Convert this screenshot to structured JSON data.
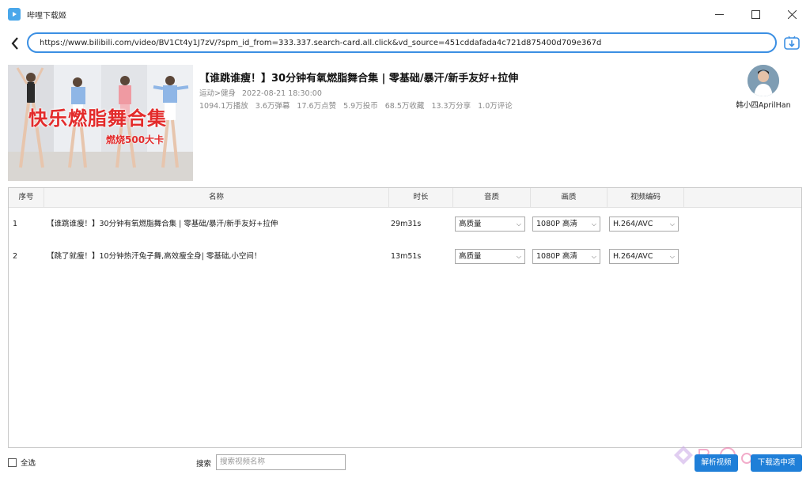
{
  "window": {
    "title": "哔哩下载姬"
  },
  "address": {
    "url": "https://www.bilibili.com/video/BV1Ct4y1J7zV/?spm_id_from=333.337.search-card.all.click&vd_source=451cddafada4c721d875400d709e367d"
  },
  "video": {
    "title": "【谁跳谁瘦！】30分钟有氧燃脂舞合集 | 零基础/暴汗/新手友好+拉伸",
    "category": "运动>健身",
    "published": "2022-08-21 18:30:00",
    "stats": [
      "1094.1万播放",
      "3.6万弹幕",
      "17.6万点赞",
      "5.9万投币",
      "68.5万收藏",
      "13.3万分享",
      "1.0万评论"
    ],
    "thumbnail_text": "快乐燃脂舞合集",
    "thumbnail_subtext": "燃烧500大卡",
    "uploader": "韩小四AprilHan"
  },
  "table": {
    "headers": [
      "序号",
      "名称",
      "时长",
      "音质",
      "画质",
      "视频编码"
    ],
    "rows": [
      {
        "index": "1",
        "name": "【谁跳谁瘦！】30分钟有氧燃脂舞合集 | 零基础/暴汗/新手友好+拉伸",
        "duration": "29m31s",
        "audio": "高质量",
        "quality": "1080P 高清",
        "codec": "H.264/AVC"
      },
      {
        "index": "2",
        "name": "【跳了就瘦！】10分钟热汗兔子舞,高效瘦全身| 零基础,小空间！",
        "duration": "13m51s",
        "audio": "高质量",
        "quality": "1080P 高清",
        "codec": "H.264/AVC"
      }
    ]
  },
  "bottom": {
    "select_all": "全选",
    "search_label": "搜索",
    "search_placeholder": "搜索视频名称",
    "parse_button": "解析视频",
    "download_button": "下载选中项"
  },
  "colors": {
    "accent": "#1f7fd8",
    "url_border": "#3b8fe3",
    "thumb_text": "#e32b2b"
  },
  "icons": {
    "app": "bilibili-tv-icon",
    "back": "chevron-left-icon",
    "go": "download-arrow-icon"
  }
}
